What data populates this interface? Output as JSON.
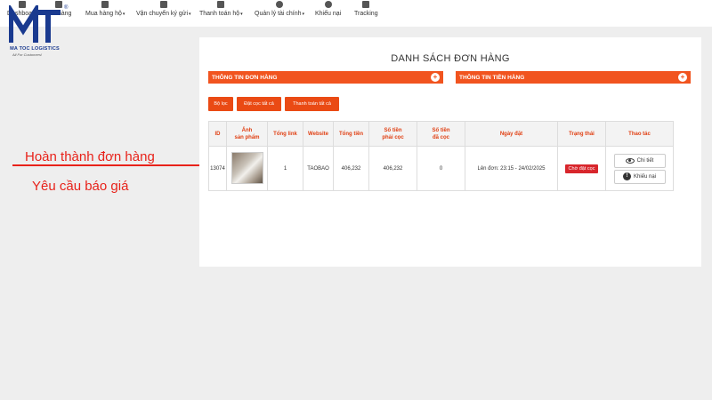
{
  "nav": {
    "items": [
      {
        "label": "Dashboard",
        "icon": "dashboard-icon"
      },
      {
        "label": "Giỏ hàng",
        "icon": "cart-icon"
      },
      {
        "label": "Mua hàng hộ",
        "icon": "shopping-icon"
      },
      {
        "label": "Vận chuyển ký gửi",
        "icon": "box-icon"
      },
      {
        "label": "Thanh toán hộ",
        "icon": "wallet-icon"
      },
      {
        "label": "Quản lý tài chính",
        "icon": "dollar-icon"
      },
      {
        "label": "Khiếu nại",
        "icon": "alert-icon"
      },
      {
        "label": "Tracking",
        "icon": "truck-icon"
      }
    ]
  },
  "logo": {
    "name": "MA TOC LOGISTICS",
    "tagline": "All For Customers!",
    "reg": "®"
  },
  "annotation": {
    "line1": "Hoàn thành đơn hàng",
    "line2": "Yêu cầu báo giá",
    "color": "#e8221a"
  },
  "panel": {
    "title": "DANH SÁCH ĐƠN HÀNG",
    "section_order": "THÔNG TIN ĐƠN HÀNG",
    "section_money": "THÔNG TIN TIỀN HÀNG",
    "accent": "#f1541f"
  },
  "buttons": {
    "filter": "Bộ lọc",
    "deposit_all": "Đặt cọc tất cả",
    "pay_all": "Thanh toán tất cả"
  },
  "table": {
    "headers": {
      "id": "ID",
      "image_l1": "Ảnh",
      "image_l2": "sản phẩm",
      "total_links": "Tổng link",
      "website": "Website",
      "total_amount": "Tổng tiền",
      "deposit_l1": "Số tiền",
      "deposit_l2": "phải cọc",
      "deposited_l1": "Số tiền",
      "deposited_l2": "đã cọc",
      "date": "Ngày đặt",
      "status": "Trạng thái",
      "actions": "Thao tác"
    },
    "rows": [
      {
        "id": "13074",
        "total_links": "1",
        "website": "TAOBAO",
        "total_amount": "406,232",
        "deposit_required": "406,232",
        "deposited": "0",
        "date": "Lên đơn: 23:15 - 24/02/2025",
        "status": "Chờ đặt cọc",
        "action_detail": "Chi tiết",
        "action_complaint": "Khiếu nại"
      }
    ]
  }
}
